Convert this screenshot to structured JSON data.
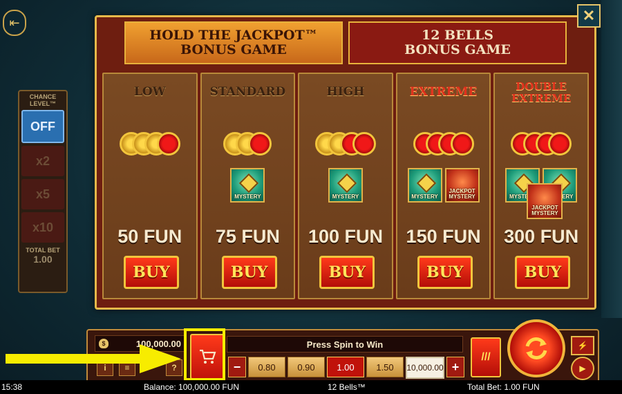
{
  "modal": {
    "tabs": [
      {
        "label": "HOLD THE JACKPOT™\nBONUS GAME",
        "active": true
      },
      {
        "label": "12 BELLS\nBONUS GAME",
        "active": false
      }
    ],
    "tiers": [
      {
        "name": "LOW",
        "price": "50 FUN",
        "buy": "BUY"
      },
      {
        "name": "STANDARD",
        "price": "75 FUN",
        "buy": "BUY"
      },
      {
        "name": "HIGH",
        "price": "100 FUN",
        "buy": "BUY"
      },
      {
        "name": "EXTREME",
        "price": "150 FUN",
        "buy": "BUY"
      },
      {
        "name": "DOUBLE EXTREME",
        "price": "300 FUN",
        "buy": "BUY"
      }
    ],
    "tile_labels": {
      "mystery": "MYSTERY",
      "jackpot_mystery": "JACKPOT MYSTERY"
    },
    "close": "✕"
  },
  "chance": {
    "title": "CHANCE LEVEL™",
    "options": [
      "OFF",
      "x2",
      "x5",
      "x10"
    ],
    "total_bet_label": "TOTAL BET",
    "total_bet_value": "1.00"
  },
  "bar": {
    "balance": "100,000.00",
    "message": "Press Spin to Win",
    "bets": [
      "0.80",
      "0.90",
      "1.00",
      "1.50",
      "10,000.00"
    ],
    "selected_bet": "1.00",
    "minus": "−",
    "plus": "+",
    "info": "i",
    "menu": "≡",
    "help": "?"
  },
  "status": {
    "time": "15:38",
    "balance": "Balance: 100,000.00 FUN",
    "game": "12 Bells™",
    "total_bet": "Total Bet: 1.00 FUN"
  },
  "colors": {
    "accent": "#f7ec00",
    "gold": "#e6b94a",
    "red": "#c0120a"
  }
}
